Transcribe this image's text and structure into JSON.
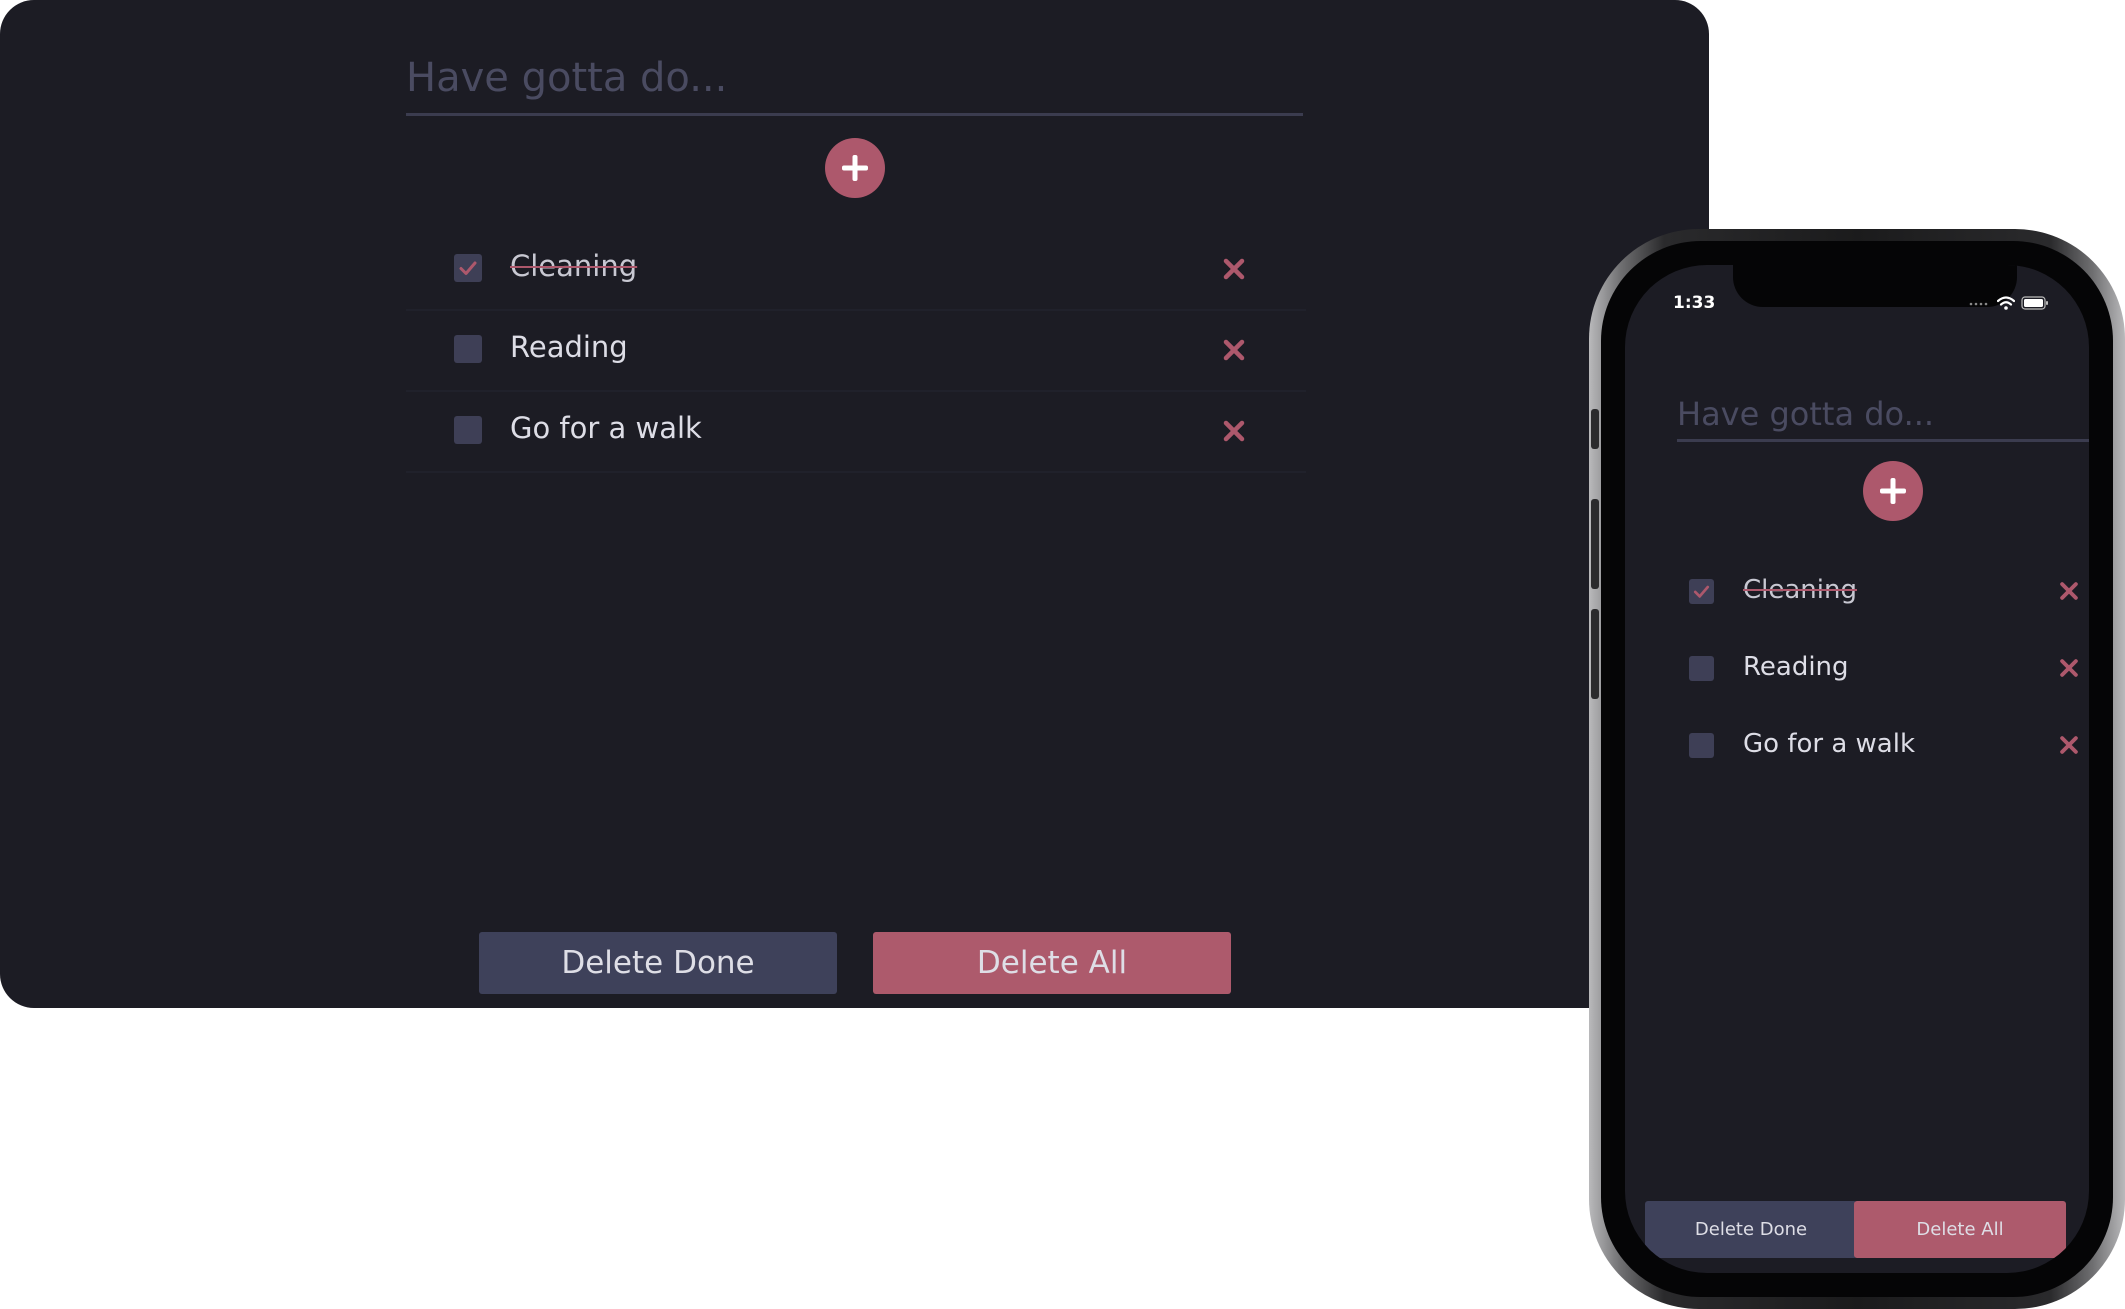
{
  "colors": {
    "background": "#1c1c24",
    "accent": "#ad586c",
    "checkbox": "#3e3f56",
    "secondary_button": "#3e415a",
    "text": "#dddde6",
    "placeholder": "#4a4b61"
  },
  "desktop": {
    "input": {
      "placeholder": "Have gotta do...",
      "value": ""
    },
    "add_button": {
      "icon": "plus-icon"
    },
    "tasks": [
      {
        "label": "Cleaning",
        "done": true
      },
      {
        "label": "Reading",
        "done": false
      },
      {
        "label": "Go for a walk",
        "done": false
      }
    ],
    "delete_done_label": "Delete Done",
    "delete_all_label": "Delete All"
  },
  "phone": {
    "status": {
      "time": "1:33",
      "icons": [
        "signal-icon",
        "wifi-icon",
        "battery-icon"
      ]
    },
    "input": {
      "placeholder": "Have gotta do...",
      "value": ""
    },
    "add_button": {
      "icon": "plus-icon"
    },
    "tasks": [
      {
        "label": "Cleaning",
        "done": true
      },
      {
        "label": "Reading",
        "done": false
      },
      {
        "label": "Go for a walk",
        "done": false
      }
    ],
    "delete_done_label": "Delete Done",
    "delete_all_label": "Delete All"
  }
}
